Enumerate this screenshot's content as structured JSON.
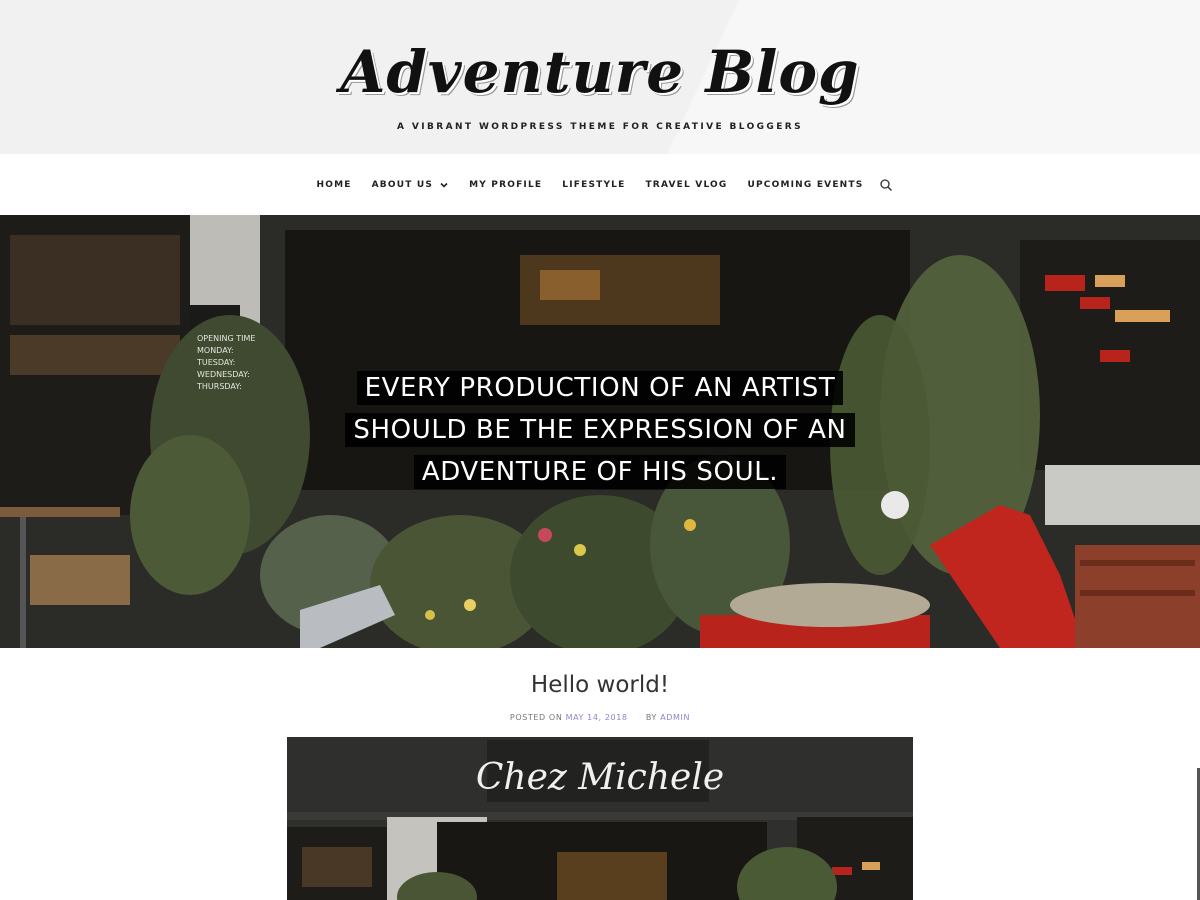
{
  "site": {
    "title": "Adventure Blog",
    "tagline": "A VIBRANT WORDPRESS THEME FOR CREATIVE BLOGGERS"
  },
  "nav": {
    "items": [
      {
        "label": "HOME"
      },
      {
        "label": "ABOUT US",
        "has_dropdown": true
      },
      {
        "label": "MY PROFILE"
      },
      {
        "label": "LIFESTYLE"
      },
      {
        "label": "TRAVEL VLOG"
      },
      {
        "label": "UPCOMING EVENTS"
      }
    ],
    "search_icon": "search-icon"
  },
  "hero": {
    "quote_lines": [
      "EVERY PRODUCTION OF AN ARTIST",
      "SHOULD BE THE EXPRESSION OF AN",
      "ADVENTURE OF HIS SOUL."
    ],
    "sign_lines": [
      "OPENING TIME",
      "MONDAY:",
      "TUESDAY:",
      "WEDNESDAY:",
      "THURSDAY:"
    ]
  },
  "post": {
    "title": "Hello world!",
    "posted_on_label": "POSTED ON",
    "date": "MAY 14, 2018",
    "by_label": "BY",
    "author": "ADMIN",
    "image_sign": "Chez Michele"
  },
  "colors": {
    "link": "#8b86c9",
    "scooter_red": "#b8231c"
  }
}
